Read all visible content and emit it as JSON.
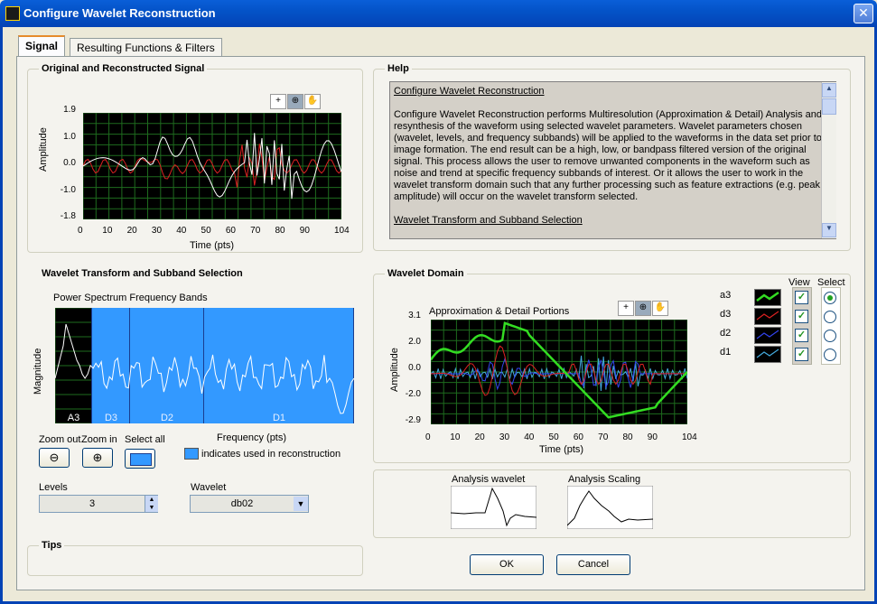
{
  "window": {
    "title": "Configure Wavelet Reconstruction",
    "close_glyph": "✕"
  },
  "tabs": [
    {
      "label": "Signal"
    },
    {
      "label": "Resulting Functions & Filters"
    }
  ],
  "signal_group": {
    "title": "Original and Reconstructed Signal",
    "ylabel": "Amplitude",
    "xlabel": "Time (pts)",
    "yticks": [
      "1.9",
      "1.0",
      "0.0",
      "-1.0",
      "-1.8"
    ],
    "xticks": [
      "0",
      "10",
      "20",
      "30",
      "40",
      "50",
      "60",
      "70",
      "80",
      "90",
      "104"
    ]
  },
  "help_group": {
    "title": "Help",
    "heading": "Configure Wavelet Reconstruction",
    "body": "Configure Wavelet Reconstruction performs Multiresolution (Approximation & Detail) Analysis and resynthesis of the waveform using selected wavelet parameters. Wavelet parameters chosen (wavelet, levels, and frequency subbands) will be applied to the waveforms in the data set prior to image formation. The end result can be a high, low, or bandpass filtered version of the original signal.  This process allows the user to remove unwanted components in the waveform such as noise and trend at specific frequency subbands of interest.  Or it allows the user to work in the wavelet transform domain such that any further processing such as feature extractions (e.g. peak amplitude) will occur on the wavelet transform selected.",
    "link2": "Wavelet Transform and Subband Selection"
  },
  "subband_group": {
    "title": "Wavelet Transform and Subband Selection",
    "plot_title": "Power Spectrum Frequency Bands",
    "ylabel": "Magnitude",
    "xlabel": "Frequency (pts)",
    "bands": [
      "A3",
      "D3",
      "D2",
      "D1"
    ],
    "zoom_out_label": "Zoom out",
    "zoom_in_label": "Zoom in",
    "select_all_label": "Select all",
    "legend_text": "indicates used in reconstruction",
    "levels_label": "Levels",
    "levels_value": "3",
    "wavelet_label": "Wavelet",
    "wavelet_value": "db02"
  },
  "tips_group": {
    "title": "Tips"
  },
  "domain_group": {
    "title": "Wavelet Domain",
    "plot_title": "Approximation & Detail Portions",
    "ylabel": "Amplitude",
    "xlabel": "Time (pts)",
    "yticks": [
      "3.1",
      "2.0",
      "0.0",
      "-2.0",
      "-2.9"
    ],
    "xticks": [
      "0",
      "10",
      "20",
      "30",
      "40",
      "50",
      "60",
      "70",
      "80",
      "90",
      "104"
    ],
    "view_header": "View",
    "select_header": "Select",
    "rows": [
      {
        "label": "a3",
        "color": "#33dd22",
        "view": "✓"
      },
      {
        "label": "d3",
        "color": "#dd2222",
        "view": "✓"
      },
      {
        "label": "d2",
        "color": "#3344ee",
        "view": "✓"
      },
      {
        "label": "d1",
        "color": "#44aadd",
        "view": "✓"
      }
    ]
  },
  "analysis": {
    "wavelet_label": "Analysis wavelet",
    "scaling_label": "Analysis Scaling"
  },
  "buttons": {
    "ok": "OK",
    "cancel": "Cancel"
  },
  "colors": {
    "plot_bg": "#000000",
    "grid": "#1e6b1e",
    "band_selected": "#3399ff",
    "titlebar": "#0453c8"
  }
}
